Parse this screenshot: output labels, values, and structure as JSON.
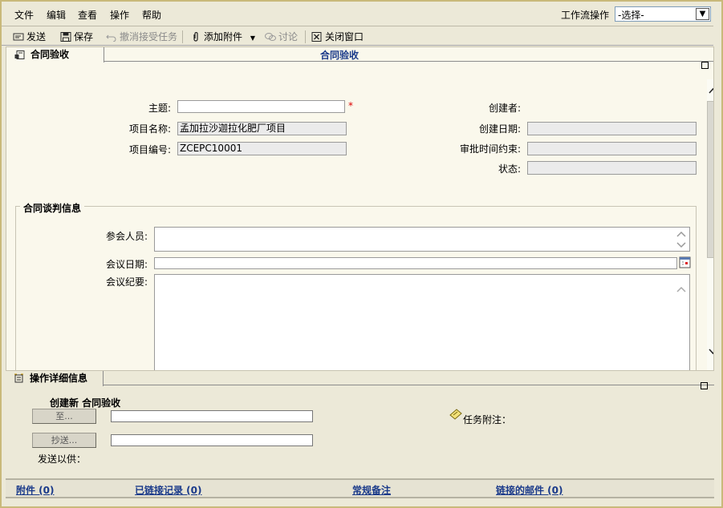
{
  "menu": [
    "文件",
    "编辑",
    "查看",
    "操作",
    "帮助"
  ],
  "workflow": {
    "label": "工作流操作",
    "selected": "-选择-"
  },
  "toolbar": {
    "send": "发送",
    "save": "保存",
    "cancel_accept": "撤消接受任务",
    "add_attachment": "添加附件",
    "discuss": "讨论",
    "close_window": "关闭窗口"
  },
  "panel": {
    "tab_label": "合同验收",
    "title": "合同验收"
  },
  "form": {
    "subject_label": "主题:",
    "subject_value": "",
    "required_mark": "*",
    "project_name_label": "项目名称:",
    "project_name_value": "孟加拉沙迦拉化肥厂项目",
    "project_no_label": "项目编号:",
    "project_no_value": "ZCEPC10001",
    "creator_label": "创建者:",
    "created_date_label": "创建日期:",
    "deadline_label": "审批时间约束:",
    "status_label": "状态:"
  },
  "negotiation": {
    "group_title": "合同谈判信息",
    "attendees_label": "参会人员:",
    "meeting_date_label": "会议日期:",
    "minutes_label": "会议纪要:"
  },
  "ops": {
    "tab_label": "操作详细信息",
    "create_new": "创建新 合同验收",
    "to_button": "至...",
    "cc_button": "抄送...",
    "send_for": "发送以供：",
    "task_note": "任务附注："
  },
  "bottom_tabs": {
    "attachments": "附件 (0)",
    "linked_records": "已链接记录 (0)",
    "general_notes": "常规备注",
    "linked_mail": "链接的邮件 (0)"
  }
}
